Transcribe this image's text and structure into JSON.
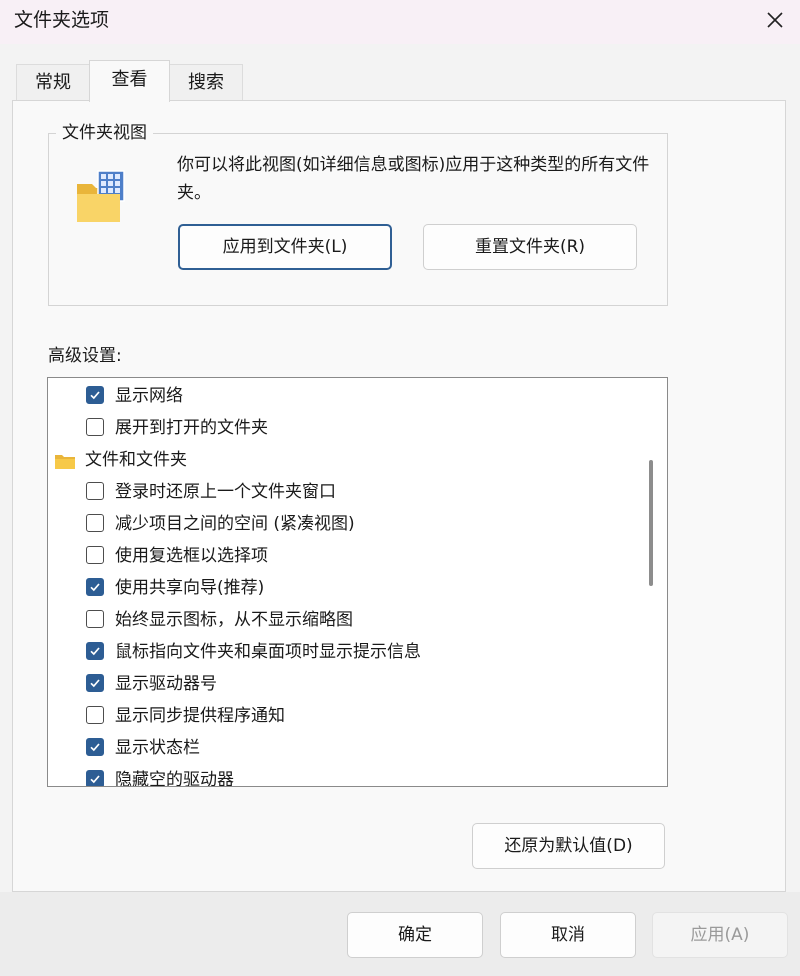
{
  "window": {
    "title": "文件夹选项"
  },
  "tabs": [
    {
      "label": "常规"
    },
    {
      "label": "查看"
    },
    {
      "label": "搜索"
    }
  ],
  "folder_views": {
    "legend": "文件夹视图",
    "description": "你可以将此视图(如详细信息或图标)应用于这种类型的所有文件夹。",
    "apply_button": "应用到文件夹(L)",
    "reset_button": "重置文件夹(R)"
  },
  "advanced": {
    "label": "高级设置:",
    "items": [
      {
        "label": "显示网络",
        "type": "checkbox",
        "checked": true
      },
      {
        "label": "展开到打开的文件夹",
        "type": "checkbox",
        "checked": false
      },
      {
        "label": "文件和文件夹",
        "type": "folder",
        "icon": "folder-icon"
      },
      {
        "label": "登录时还原上一个文件夹窗口",
        "type": "checkbox",
        "checked": false
      },
      {
        "label": "减少项目之间的空间 (紧凑视图)",
        "type": "checkbox",
        "checked": false
      },
      {
        "label": "使用复选框以选择项",
        "type": "checkbox",
        "checked": false
      },
      {
        "label": "使用共享向导(推荐)",
        "type": "checkbox",
        "checked": true
      },
      {
        "label": "始终显示图标，从不显示缩略图",
        "type": "checkbox",
        "checked": false
      },
      {
        "label": "鼠标指向文件夹和桌面项时显示提示信息",
        "type": "checkbox",
        "checked": true
      },
      {
        "label": "显示驱动器号",
        "type": "checkbox",
        "checked": true
      },
      {
        "label": "显示同步提供程序通知",
        "type": "checkbox",
        "checked": false
      },
      {
        "label": "显示状态栏",
        "type": "checkbox",
        "checked": true
      },
      {
        "label": "隐藏空的驱动器",
        "type": "checkbox",
        "checked": true
      }
    ]
  },
  "restore_defaults_button": "还原为默认值(D)",
  "footer": {
    "ok_button": "确定",
    "cancel_button": "取消",
    "apply_button": "应用(A)"
  },
  "colors": {
    "accent": "#2d5d94",
    "titlebar_bg": "#f8f0f6",
    "panel_bg": "#f9f9f9",
    "folder_yellow": "#f7c948"
  }
}
